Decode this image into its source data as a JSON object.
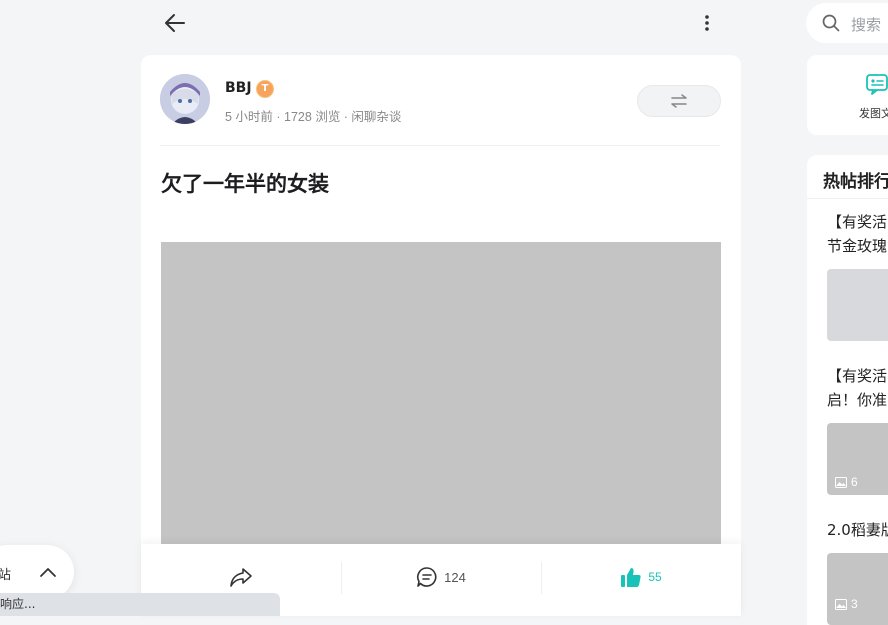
{
  "header": {
    "back_icon": "arrow-left-icon",
    "more_icon": "more-vertical-icon"
  },
  "post": {
    "author": "BBJ",
    "level_badge_text": "T",
    "meta": "5 小时前 · 1728 浏览 · 闲聊杂谈",
    "title": "欠了一年半的女装",
    "switch_icon": "swap-arrows-icon",
    "image_kind": "photo"
  },
  "actions": {
    "share_icon": "share-icon",
    "comment_icon": "comment-icon",
    "comment_count": "124",
    "like_icon": "thumbs-up-icon",
    "like_count": "55"
  },
  "sidebar": {
    "search_placeholder": "搜索",
    "publish_label": "发图文",
    "hot_title": "热帖排行",
    "hot_items": [
      {
        "line1": "【有奖活",
        "line2": "节金玫瑰",
        "thumb_count": ""
      },
      {
        "line1": "【有奖活",
        "line2": "启！你准",
        "thumb_count": "6"
      },
      {
        "line1": "2.0稻妻版",
        "line2": "",
        "thumb_count": "3"
      }
    ]
  },
  "floating": {
    "pill_label": "站",
    "collapse_icon": "chevron-up-icon"
  },
  "status_bar": {
    "text": "响应..."
  },
  "colors": {
    "page_bg": "#f4f5f7",
    "card_bg": "#ffffff",
    "accent_teal": "#19c2b8",
    "badge_orange": "#f7a35c"
  }
}
